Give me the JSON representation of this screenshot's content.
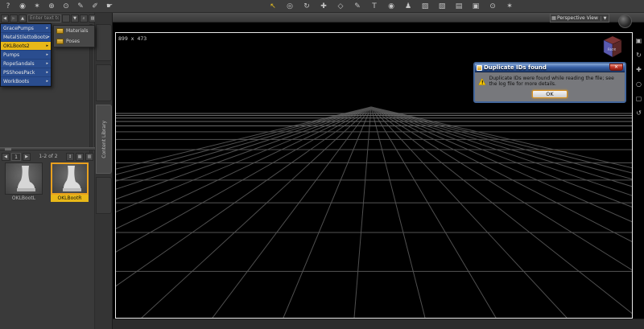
{
  "colors": {
    "accent_yellow": "#e8b818",
    "selection_orange": "#e8a020",
    "menu_blue": "#2a4d8f",
    "dialog_title_blue": "#3a63a8",
    "warning_yellow": "#f7c600"
  },
  "glyphs": {
    "dropdown_arrow": "▼",
    "menu_arrow": "▸",
    "back": "◀",
    "forward": "▶",
    "up": "▲",
    "search": "⌕",
    "corner": "▨",
    "sort": "↕",
    "grid_view": "▦",
    "list_view": "▥"
  },
  "toolbar_left": {
    "icons": [
      {
        "name": "help",
        "glyph": "?"
      },
      {
        "name": "camera",
        "glyph": "◉"
      },
      {
        "name": "wand",
        "glyph": "✶"
      },
      {
        "name": "info",
        "glyph": "⊕"
      },
      {
        "name": "clock",
        "glyph": "⊙"
      },
      {
        "name": "spray",
        "glyph": "✎"
      },
      {
        "name": "brush",
        "glyph": "✐"
      },
      {
        "name": "pointer",
        "glyph": "☛"
      }
    ]
  },
  "toolbar_main": {
    "icons": [
      {
        "name": "select-tool",
        "glyph": "↖",
        "selected": true
      },
      {
        "name": "orbit-tool",
        "glyph": "◎"
      },
      {
        "name": "rotate-tool",
        "glyph": "↻"
      },
      {
        "name": "translate-tool",
        "glyph": "✚"
      },
      {
        "name": "scale-tool",
        "glyph": "◇"
      },
      {
        "name": "style-tool",
        "glyph": "✎"
      },
      {
        "name": "text-tool",
        "glyph": "T"
      },
      {
        "name": "node-tool",
        "glyph": "◉"
      },
      {
        "name": "figure-tool",
        "glyph": "♟"
      },
      {
        "name": "surface-tool",
        "glyph": "▨"
      },
      {
        "name": "shader-tool",
        "glyph": "▧"
      },
      {
        "name": "uv-tool",
        "glyph": "▤"
      },
      {
        "name": "render-tool",
        "glyph": "▣"
      },
      {
        "name": "camera-tool",
        "glyph": "⊙"
      },
      {
        "name": "light-tool",
        "glyph": "✶"
      }
    ]
  },
  "left_panel": {
    "search": {
      "placeholder": "Enter text to searc..."
    },
    "menu": {
      "items": [
        {
          "label": "GracePumps",
          "selected": false
        },
        {
          "label": "MetalStilettoBoots",
          "selected": false
        },
        {
          "label": "OKLBoots2",
          "selected": true
        },
        {
          "label": "Pumps",
          "selected": false
        },
        {
          "label": "RopeSandals",
          "selected": false
        },
        {
          "label": "PSShoesPack",
          "selected": false
        },
        {
          "label": "WorkBoots",
          "selected": false
        }
      ]
    },
    "submenu": {
      "items": [
        {
          "label": "Materials"
        },
        {
          "label": "Poses"
        }
      ]
    },
    "pagination": {
      "page": "1",
      "range_label": "1-2 of 2"
    },
    "thumbnails": [
      {
        "label": "OKLBootL",
        "selected": false
      },
      {
        "label": "OKLBootR",
        "selected": true
      }
    ]
  },
  "tabs": {
    "items": [
      {
        "label": ""
      },
      {
        "label": ""
      },
      {
        "label": "Content Library",
        "selected": true
      },
      {
        "label": ""
      }
    ]
  },
  "viewport": {
    "view_selector": "Perspective View",
    "dimensions_label": "899 x 473",
    "cube_face_label": "Face",
    "tools": [
      {
        "name": "cube",
        "glyph": "▣"
      },
      {
        "name": "orbit",
        "glyph": "↻"
      },
      {
        "name": "pan",
        "glyph": "✚"
      },
      {
        "name": "zoom",
        "glyph": "○"
      },
      {
        "name": "frame",
        "glyph": "▢"
      },
      {
        "name": "spin",
        "glyph": "↺"
      }
    ]
  },
  "dialog": {
    "title": "Duplicate IDs found",
    "message": "Duplicate IDs were found while reading the file; see the log file for more details.",
    "ok_label": "OK",
    "close_label": "✕"
  }
}
